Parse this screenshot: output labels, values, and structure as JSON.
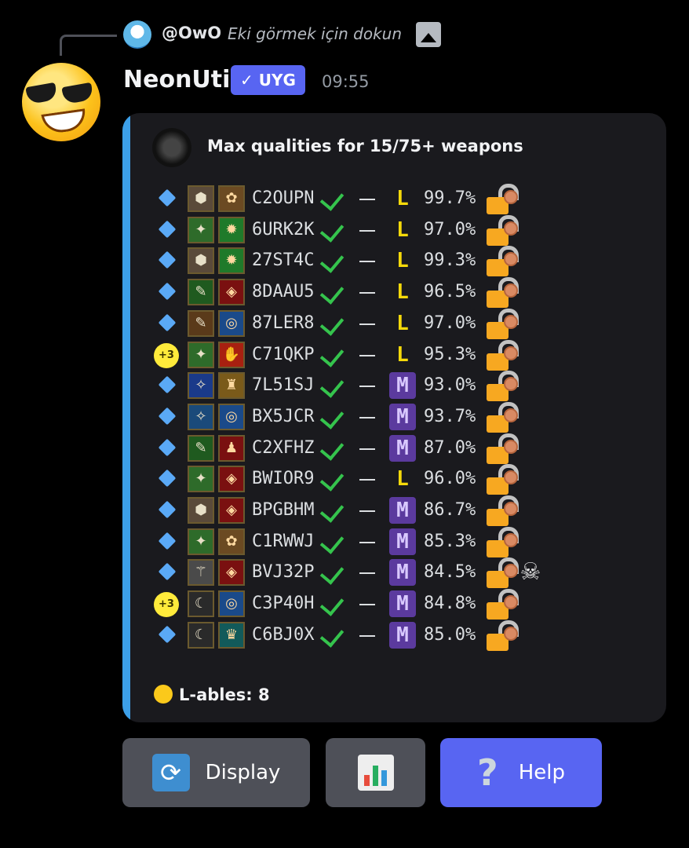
{
  "reply": {
    "user": "@OwO",
    "text": "Eki görmek için dokun",
    "icon": "image-icon"
  },
  "message": {
    "username": "NeonUtil",
    "badge": "✓ UYG",
    "time": "09:55"
  },
  "embed": {
    "accent_color": "#3c9fe8",
    "title": "Max qualities for 15/75+ weapons",
    "rows": [
      {
        "marker": "diamond",
        "code": "C2OUPN",
        "grade": "L",
        "pct": "99.7%",
        "skull": false
      },
      {
        "marker": "diamond",
        "code": "6URK2K",
        "grade": "L",
        "pct": "97.0%",
        "skull": false
      },
      {
        "marker": "diamond",
        "code": "27ST4C",
        "grade": "L",
        "pct": "99.3%",
        "skull": false
      },
      {
        "marker": "diamond",
        "code": "8DAAU5",
        "grade": "L",
        "pct": "96.5%",
        "skull": false
      },
      {
        "marker": "diamond",
        "code": "87LER8",
        "grade": "L",
        "pct": "97.0%",
        "skull": false
      },
      {
        "marker": "+3",
        "code": "C71QKP",
        "grade": "L",
        "pct": "95.3%",
        "skull": false
      },
      {
        "marker": "diamond",
        "code": "7L51SJ",
        "grade": "M",
        "pct": "93.0%",
        "skull": false
      },
      {
        "marker": "diamond",
        "code": "BX5JCR",
        "grade": "M",
        "pct": "93.7%",
        "skull": false
      },
      {
        "marker": "diamond",
        "code": "C2XFHZ",
        "grade": "M",
        "pct": "87.0%",
        "skull": false
      },
      {
        "marker": "diamond",
        "code": "BWIOR9",
        "grade": "L",
        "pct": "96.0%",
        "skull": false
      },
      {
        "marker": "diamond",
        "code": "BPGBHM",
        "grade": "M",
        "pct": "86.7%",
        "skull": false
      },
      {
        "marker": "diamond",
        "code": "C1RWWJ",
        "grade": "M",
        "pct": "85.3%",
        "skull": false
      },
      {
        "marker": "diamond",
        "code": "BVJ32P",
        "grade": "M",
        "pct": "84.5%",
        "skull": true
      },
      {
        "marker": "+3",
        "code": "C3P40H",
        "grade": "M",
        "pct": "84.8%",
        "skull": false
      },
      {
        "marker": "diamond",
        "code": "C6BJ0X",
        "grade": "M",
        "pct": "85.0%",
        "skull": false
      }
    ],
    "footer": "L-ables: 8"
  },
  "buttons": [
    {
      "label": "Display",
      "icon": "refresh-icon"
    },
    {
      "label": "",
      "icon": "bar-chart-icon"
    },
    {
      "label": "Help",
      "icon": "question-icon"
    }
  ]
}
